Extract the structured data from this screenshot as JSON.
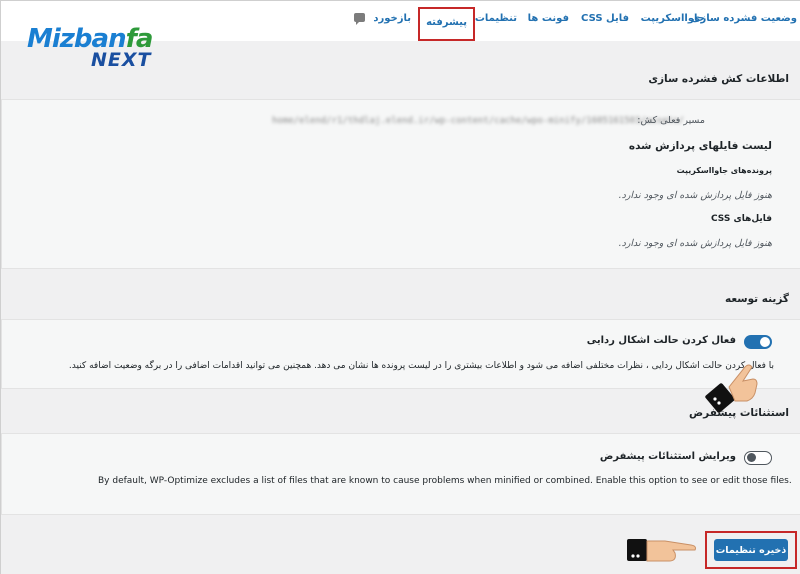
{
  "logo": {
    "brand_main": "Mizban",
    "brand_accent": "fa",
    "brand_sub": "NEXT"
  },
  "tabs": [
    {
      "label": "وضعیت فشرده سازی"
    },
    {
      "label": "جاوااسکریپت"
    },
    {
      "label": "فایل CSS"
    },
    {
      "label": "فونت ها"
    },
    {
      "label": "تنظیمات"
    },
    {
      "label": "پیشرفته"
    },
    {
      "label": "بازخورد"
    }
  ],
  "cache_section": {
    "heading": "اطلاعات کش فشرده سازی",
    "path_label": "مسیر فعلی کش:",
    "path_value": "home/elend/r1/thdlaj.elend.ir/wp-content/cache/wpo-minify/1605161503/assets/",
    "processed_heading": "لیست فایلهای پردازش شده",
    "js_files_label": "پرونده‌های جاوااسکریپت",
    "js_empty": "هنوز فایل پردازش شده ای وجود ندارد.",
    "css_files_label": "فایل‌های CSS",
    "css_empty": "هنوز فایل پردازش شده ای وجود ندارد."
  },
  "dev_section": {
    "heading": "گزینه توسعه",
    "toggle_label": "فعال کردن حالت اشکال ردایی",
    "toggle_on": true,
    "description": "با فعال کردن حالت اشکال ردایی ، نظرات مختلفی اضافه می شود و اطلاعات بیشتری را در لیست پرونده ها نشان می دهد. همچنین می توانید اقدامات اضافی را در برگه وضعیت اضافه کنید."
  },
  "exclusions_section": {
    "heading": "استثنائات پیشفرض",
    "toggle_label": "ویرایش استثنائات پیشفرض",
    "toggle_on": false,
    "description": "By default, WP-Optimize excludes a list of files that are known to cause problems when minified or combined. Enable this option to see or edit those files."
  },
  "save_button": {
    "label": "ذخیره تنظیمات"
  },
  "colors": {
    "accent": "#2271b1",
    "highlight": "#c62828",
    "panel_bg": "#f6f7f7",
    "page_bg": "#f0f0f1"
  }
}
